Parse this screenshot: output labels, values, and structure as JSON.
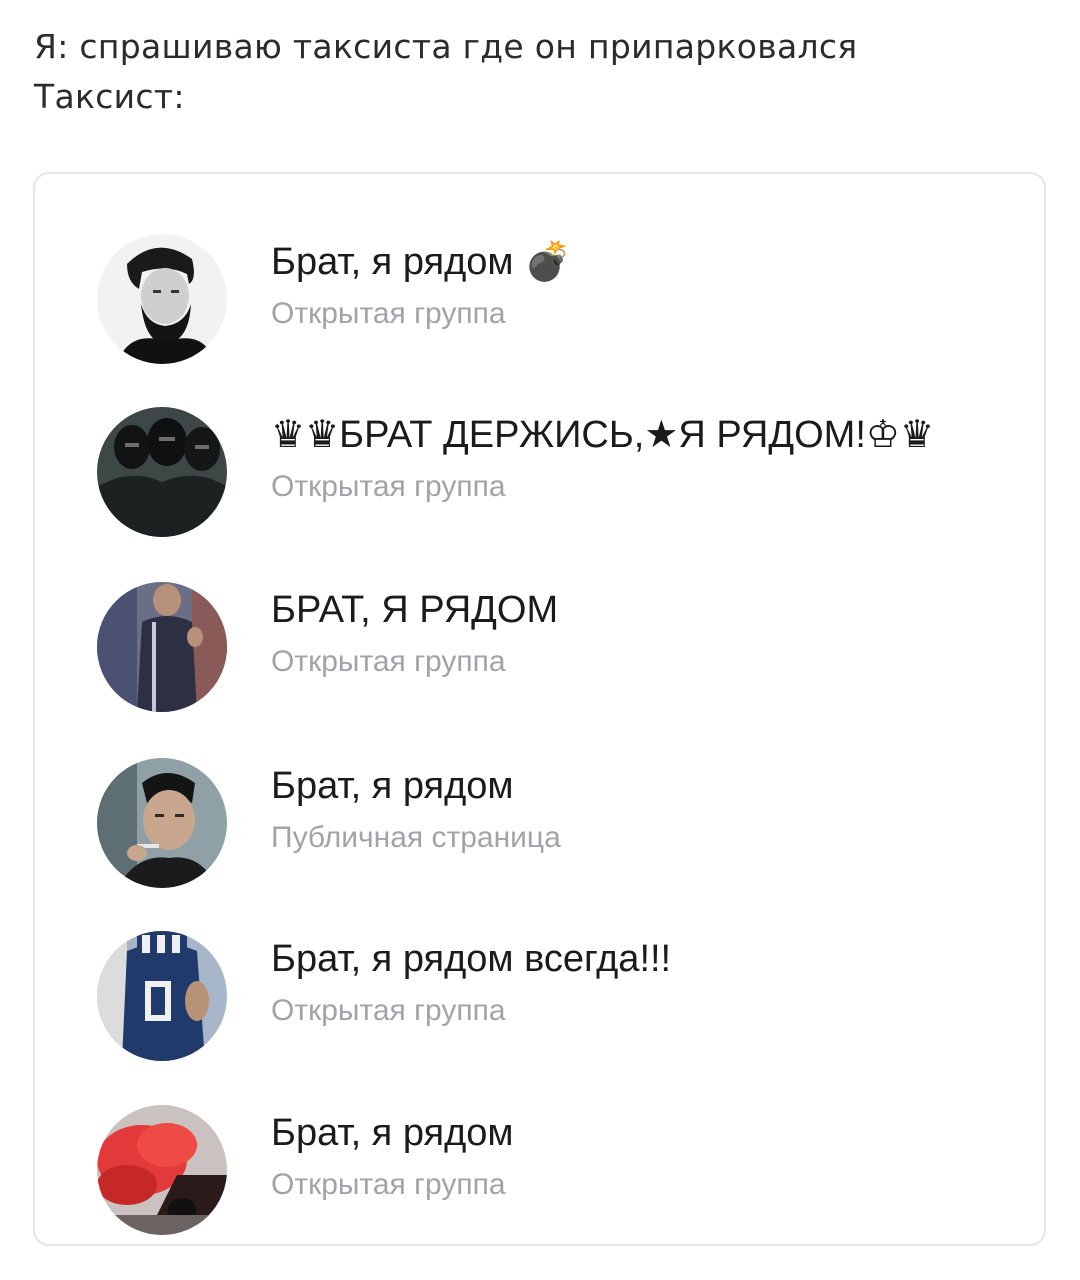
{
  "caption": {
    "line1": "Я: спрашиваю таксиста где он припарковался",
    "line2": "Таксист:"
  },
  "groups": [
    {
      "title": "Брат, я рядом 💣",
      "type": "Открытая группа",
      "avatar_icon": "bearded-man-avatar"
    },
    {
      "title": "♛♛БРАТ ДЕРЖИСЬ,★Я РЯДОМ!♔♛",
      "type": "Открытая группа",
      "avatar_icon": "masked-men-avatar"
    },
    {
      "title": "БРАТ, Я РЯДОМ",
      "type": "Открытая группа",
      "avatar_icon": "man-in-tracksuit-avatar"
    },
    {
      "title": "Брат, я рядом",
      "type": "Публичная страница",
      "avatar_icon": "smoking-man-avatar"
    },
    {
      "title": "Брат, я рядом всегда!!!",
      "type": "Открытая группа",
      "avatar_icon": "man-in-jersey-avatar"
    },
    {
      "title": "Брат, я рядом",
      "type": "Открытая группа",
      "avatar_icon": "red-smoke-car-avatar"
    }
  ]
}
